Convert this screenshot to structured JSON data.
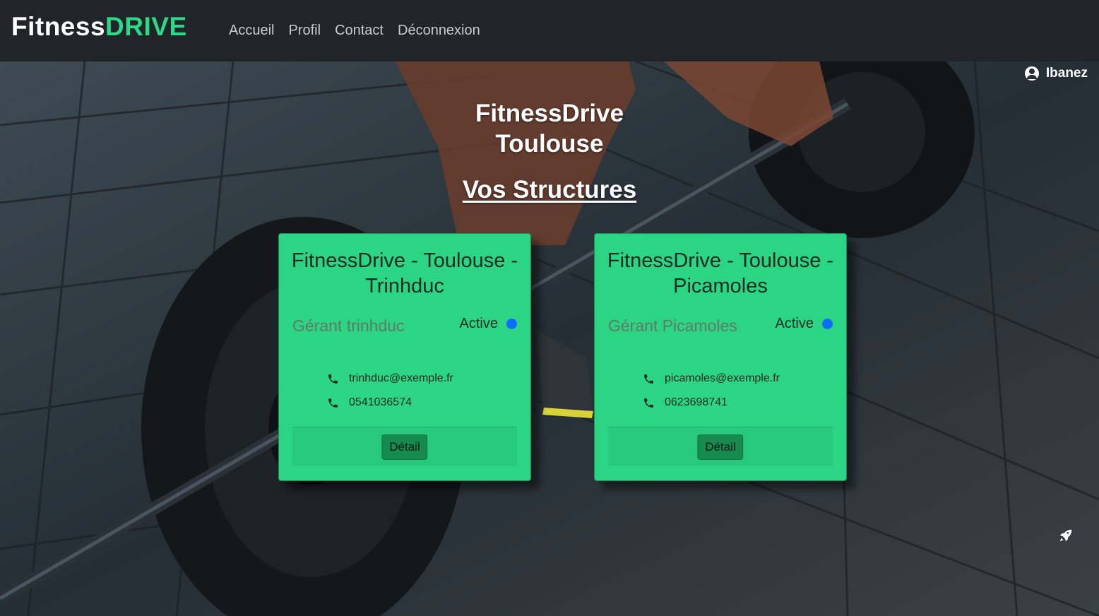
{
  "navbar": {
    "brand_main": "Fitness",
    "brand_accent": "DRIVE",
    "links": [
      "Accueil",
      "Profil",
      "Contact",
      "Déconnexion"
    ]
  },
  "user": {
    "name": "Ibanez",
    "icon": "user-circle-icon"
  },
  "hero": {
    "city_line1": "FitnessDrive",
    "city_line2": "Toulouse",
    "section_title": "Vos Structures"
  },
  "structures": [
    {
      "title": "FitnessDrive - Toulouse - Trinhduc",
      "manager": "Gérant trinhduc",
      "status": "Active",
      "email": "trinhduc@exemple.fr",
      "phone": "0541036574",
      "detail_label": "Détail"
    },
    {
      "title": "FitnessDrive - Toulouse - Picamoles",
      "manager": "Gérant Picamoles",
      "status": "Active",
      "email": "picamoles@exemple.fr",
      "phone": "0623698741",
      "detail_label": "Détail"
    }
  ],
  "colors": {
    "brand_accent": "#2dd986",
    "card_bg": "#2bd583",
    "status_dot": "#0d6efd",
    "navbar_bg": "#212429"
  }
}
